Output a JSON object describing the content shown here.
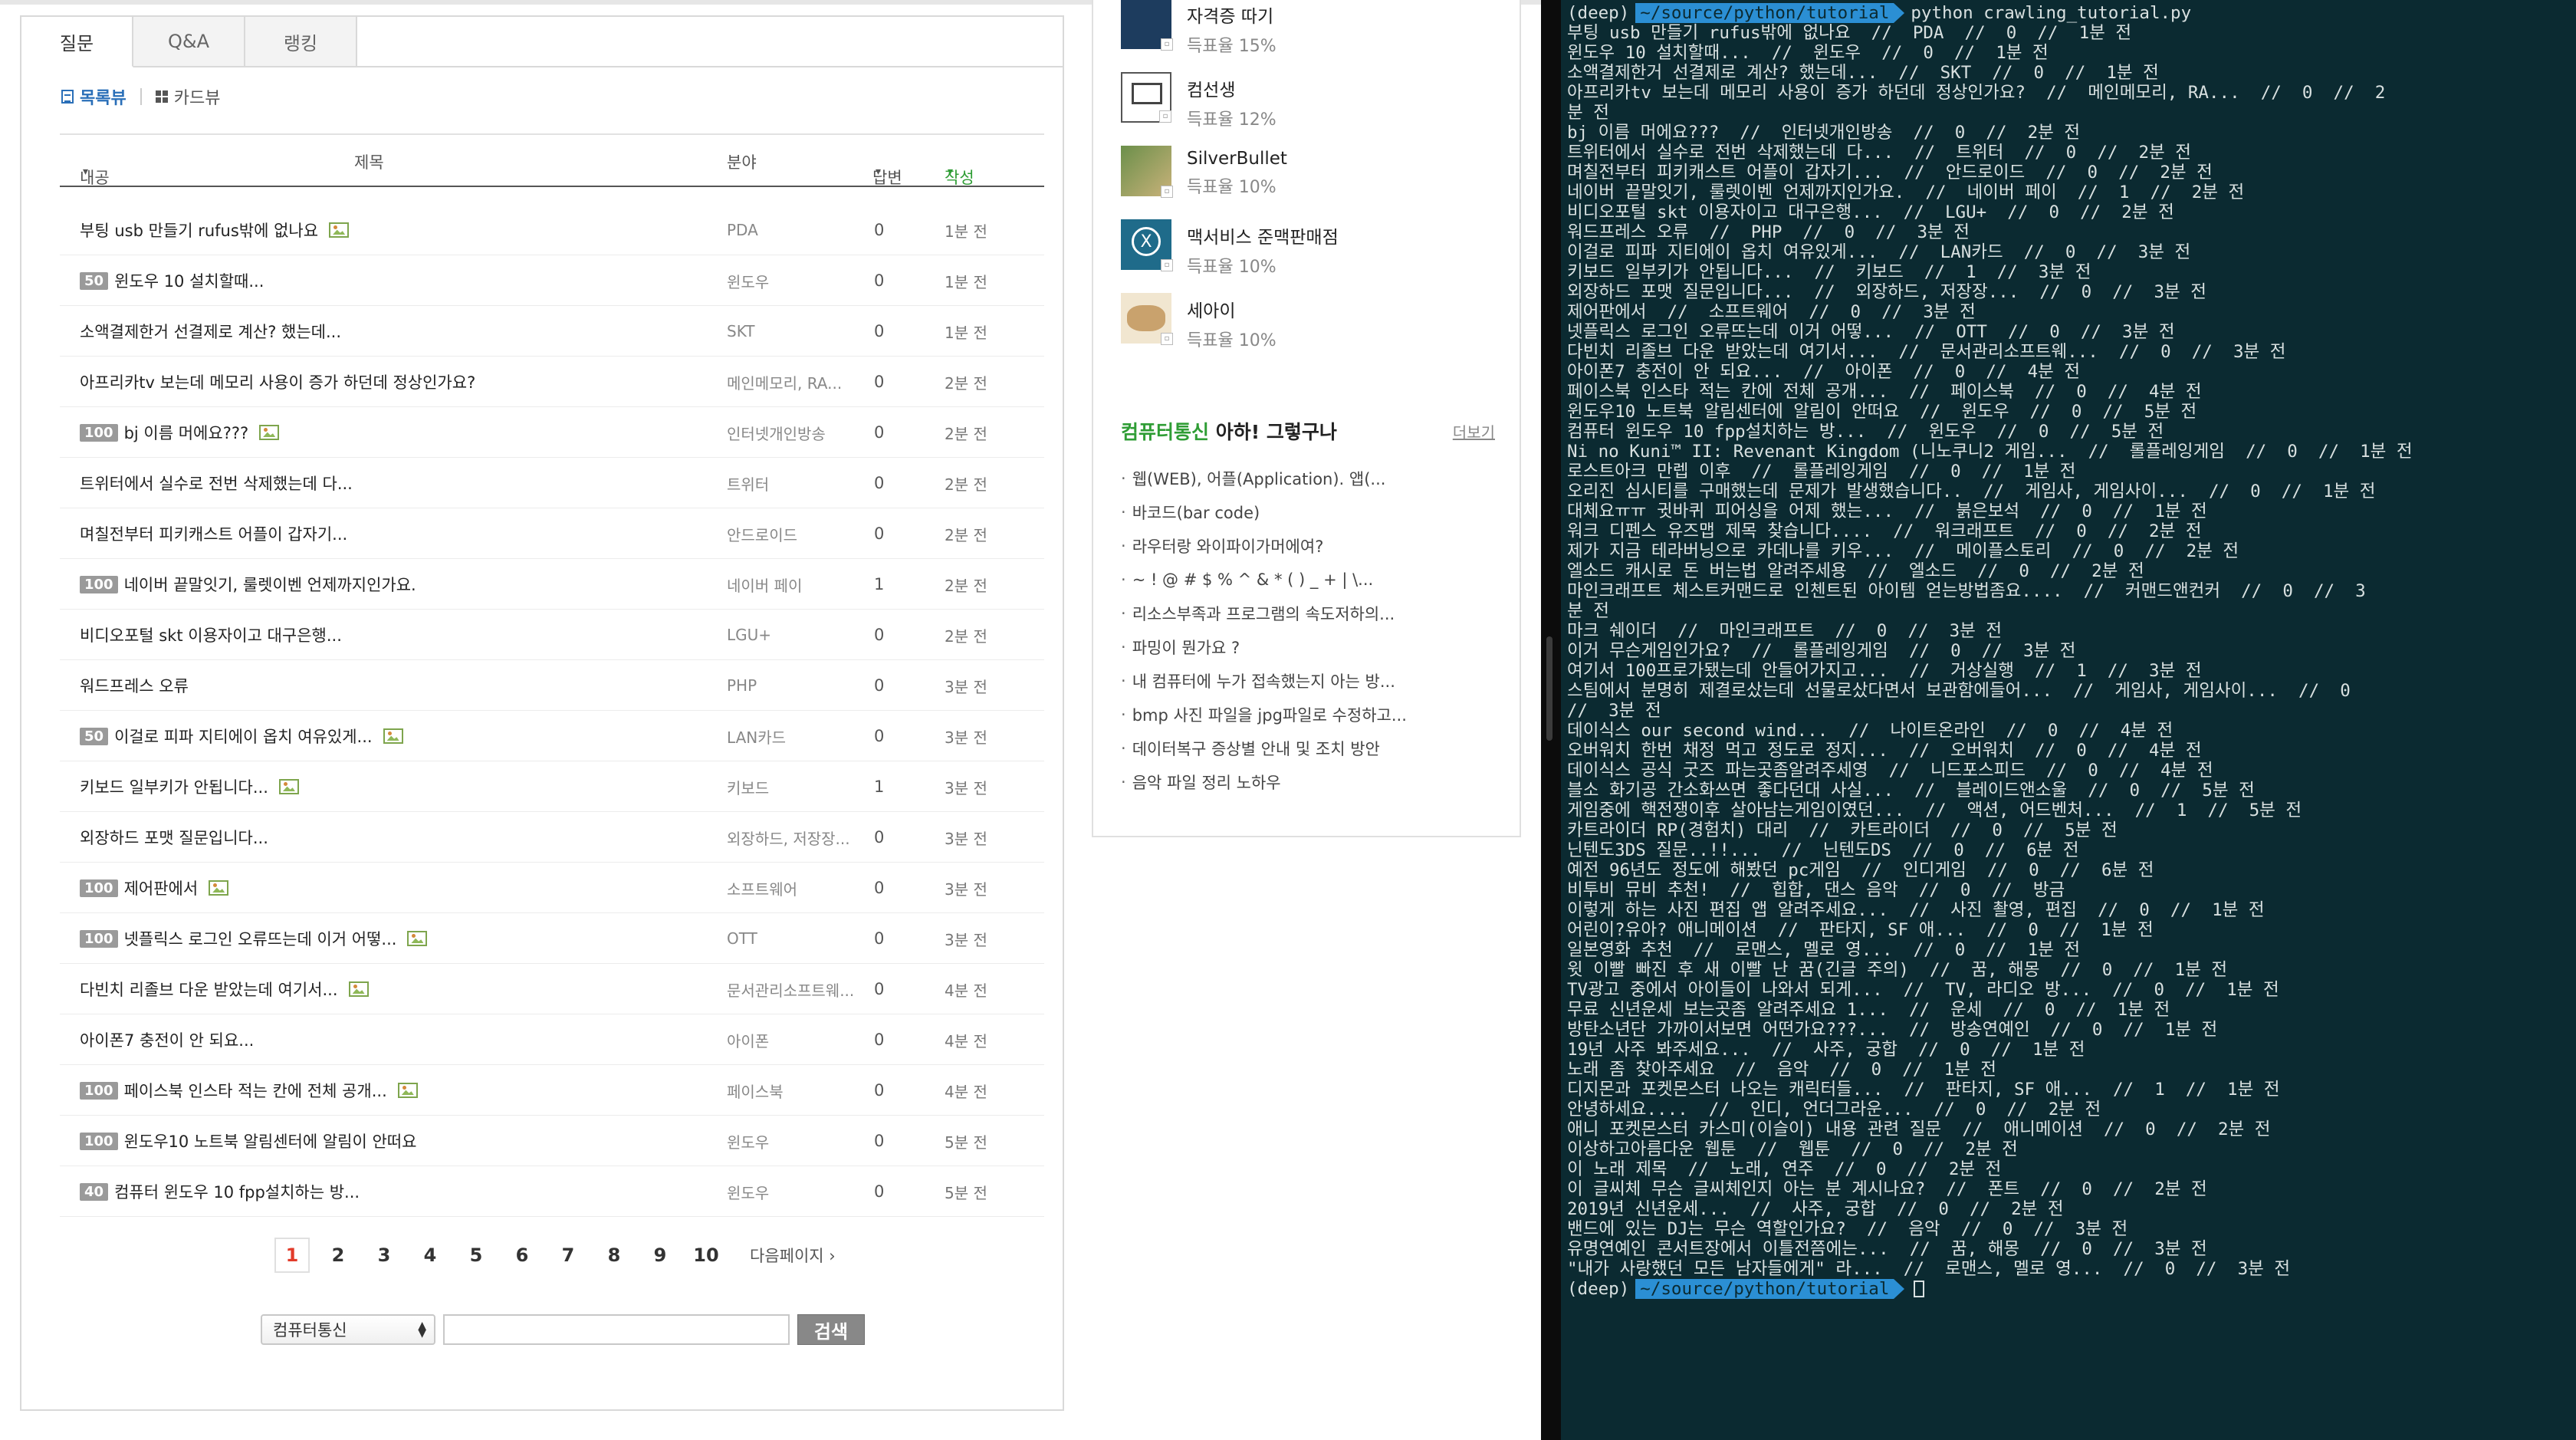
{
  "tabs": [
    "질문",
    "Q&A",
    "랭킹"
  ],
  "views": {
    "list": "목록뷰",
    "card": "카드뷰"
  },
  "columns": {
    "content": "내공",
    "title": "제목",
    "field": "분야",
    "answers": "답변",
    "written": "작성"
  },
  "questions": [
    {
      "badge": "",
      "title": "부팅 usb 만들기 rufus밖에 없나요",
      "img": true,
      "field": "PDA",
      "answers": "0",
      "time": "1분 전"
    },
    {
      "badge": "50",
      "title": "윈도우 10 설치할때...",
      "img": false,
      "field": "윈도우",
      "answers": "0",
      "time": "1분 전"
    },
    {
      "badge": "",
      "title": "소액결제한거 선결제로 계산? 했는데...",
      "img": false,
      "field": "SKT",
      "answers": "0",
      "time": "1분 전"
    },
    {
      "badge": "",
      "title": "아프리카tv 보는데 메모리 사용이 증가 하던데 정상인가요?",
      "img": false,
      "field": "메인메모리, RA...",
      "answers": "0",
      "time": "2분 전"
    },
    {
      "badge": "100",
      "title": "bj 이름 머에요???",
      "img": true,
      "field": "인터넷개인방송",
      "answers": "0",
      "time": "2분 전"
    },
    {
      "badge": "",
      "title": "트위터에서 실수로 전번 삭제했는데 다...",
      "img": false,
      "field": "트위터",
      "answers": "0",
      "time": "2분 전"
    },
    {
      "badge": "",
      "title": "며칠전부터 피키캐스트 어플이 갑자기...",
      "img": false,
      "field": "안드로이드",
      "answers": "0",
      "time": "2분 전"
    },
    {
      "badge": "100",
      "title": "네이버 끝말잇기, 룰렛이벤 언제까지인가요.",
      "img": false,
      "field": "네이버 페이",
      "answers": "1",
      "time": "2분 전"
    },
    {
      "badge": "",
      "title": "비디오포털 skt 이용자이고 대구은행...",
      "img": false,
      "field": "LGU+",
      "answers": "0",
      "time": "2분 전"
    },
    {
      "badge": "",
      "title": "워드프레스 오류",
      "img": false,
      "field": "PHP",
      "answers": "0",
      "time": "3분 전"
    },
    {
      "badge": "50",
      "title": "이걸로 피파 지티에이 옵치 여유있게...",
      "img": true,
      "field": "LAN카드",
      "answers": "0",
      "time": "3분 전"
    },
    {
      "badge": "",
      "title": "키보드 일부키가 안됩니다...",
      "img": true,
      "field": "키보드",
      "answers": "1",
      "time": "3분 전"
    },
    {
      "badge": "",
      "title": "외장하드 포맷 질문입니다...",
      "img": false,
      "field": "외장하드, 저장장...",
      "answers": "0",
      "time": "3분 전"
    },
    {
      "badge": "100",
      "title": "제어판에서",
      "img": true,
      "field": "소프트웨어",
      "answers": "0",
      "time": "3분 전"
    },
    {
      "badge": "100",
      "title": "넷플릭스 로그인 오류뜨는데 이거 어떻...",
      "img": true,
      "field": "OTT",
      "answers": "0",
      "time": "3분 전"
    },
    {
      "badge": "",
      "title": "다빈치 리졸브 다운 받았는데 여기서...",
      "img": true,
      "field": "문서관리소프트웨...",
      "answers": "0",
      "time": "4분 전"
    },
    {
      "badge": "",
      "title": "아이폰7 충전이 안 되요...",
      "img": false,
      "field": "아이폰",
      "answers": "0",
      "time": "4분 전"
    },
    {
      "badge": "100",
      "title": "페이스북 인스타 적는 칸에 전체 공개...",
      "img": true,
      "field": "페이스북",
      "answers": "0",
      "time": "4분 전"
    },
    {
      "badge": "100",
      "title": "윈도우10 노트북 알림센터에 알림이 안떠요",
      "img": false,
      "field": "윈도우",
      "answers": "0",
      "time": "5분 전"
    },
    {
      "badge": "40",
      "title": "컴퓨터 윈도우 10 fpp설치하는 방...",
      "img": false,
      "field": "윈도우",
      "answers": "0",
      "time": "5분 전"
    }
  ],
  "pagination": {
    "pages": [
      "1",
      "2",
      "3",
      "4",
      "5",
      "6",
      "7",
      "8",
      "9",
      "10"
    ],
    "current": "1",
    "next": "다음페이지"
  },
  "search": {
    "category": "컴퓨터통신",
    "value": "",
    "button": "검색"
  },
  "ranking": [
    {
      "name": "자격증 따기",
      "pct": "득표율 15%"
    },
    {
      "name": "컴선생",
      "pct": "득표율 12%"
    },
    {
      "name": "SilverBullet",
      "pct": "득표율 10%"
    },
    {
      "name": "맥서비스 준맥판매점",
      "pct": "득표율 10%"
    },
    {
      "name": "세아이",
      "pct": "득표율 10%"
    }
  ],
  "aha": {
    "title_green": "컴퓨터통신",
    "title_black": "아하! 그렇구나",
    "more": "더보기",
    "items": [
      "웹(WEB), 어플(Application). 앱(...",
      "바코드(bar code)",
      "라우터랑 와이파이가머에여?",
      "~ ! @ # $ % ^ & * ( ) _ + | \\...",
      "리소스부족과 프로그램의 속도저하의...",
      "파밍이 뭔가요 ?",
      "내 컴퓨터에 누가 접속했는지 아는 방...",
      "bmp 사진 파일을 jpg파일로 수정하고...",
      "데이터복구 증상별 안내 및 조치 방안",
      "음악 파일 정리 노하우"
    ]
  },
  "terminal": {
    "top_prompt": {
      "env": "(deep)",
      "path": "~/source/python/tutorial",
      "cmd": "python crawling_tutorial.py"
    },
    "lines": [
      "부팅 usb 만들기 rufus밖에 없나요  //  PDA  //  0  //  1분 전",
      "윈도우 10 설치할때...  //  윈도우  //  0  //  1분 전",
      "소액결제한거 선결제로 계산? 했는데...  //  SKT  //  0  //  1분 전",
      "아프리카tv 보는데 메모리 사용이 증가 하던데 정상인가요?  //  메인메모리, RA...  //  0  //  2",
      "분 전",
      "bj 이름 머에요???  //  인터넷개인방송  //  0  //  2분 전",
      "트위터에서 실수로 전번 삭제했는데 다...  //  트위터  //  0  //  2분 전",
      "며칠전부터 피키캐스트 어플이 갑자기...  //  안드로이드  //  0  //  2분 전",
      "네이버 끝말잇기, 룰렛이벤 언제까지인가요.  //  네이버 페이  //  1  //  2분 전",
      "비디오포털 skt 이용자이고 대구은행...  //  LGU+  //  0  //  2분 전",
      "워드프레스 오류  //  PHP  //  0  //  3분 전",
      "이걸로 피파 지티에이 옵치 여유있게...  //  LAN카드  //  0  //  3분 전",
      "키보드 일부키가 안됩니다...  //  키보드  //  1  //  3분 전",
      "외장하드 포맷 질문입니다...  //  외장하드, 저장장...  //  0  //  3분 전",
      "제어판에서  //  소프트웨어  //  0  //  3분 전",
      "넷플릭스 로그인 오류뜨는데 이거 어떻...  //  OTT  //  0  //  3분 전",
      "다빈치 리졸브 다운 받았는데 여기서...  //  문서관리소프트웨...  //  0  //  3분 전",
      "아이폰7 충전이 안 되요...  //  아이폰  //  0  //  4분 전",
      "페이스북 인스타 적는 칸에 전체 공개...  //  페이스북  //  0  //  4분 전",
      "윈도우10 노트북 알림센터에 알림이 안떠요  //  윈도우  //  0  //  5분 전",
      "컴퓨터 윈도우 10 fpp설치하는 방...  //  윈도우  //  0  //  5분 전",
      "Ni no Kuni™ II: Revenant Kingdom (니노쿠니2 게임...  //  롤플레잉게임  //  0  //  1분 전",
      "로스트아크 만렙 이후  //  롤플레잉게임  //  0  //  1분 전",
      "오리진 심시티를 구매했는데 문제가 발생했습니다..  //  게임사, 게임사이...  //  0  //  1분 전",
      "대체요ㅠㅠ 귓바퀴 피어싱을 어제 했는...  //  붉은보석  //  0  //  1분 전",
      "워크 디펜스 유즈맵 제목 찾습니다....  //  워크래프트  //  0  //  2분 전",
      "제가 지금 테라버닝으로 카데나를 키우...  //  메이플스토리  //  0  //  2분 전",
      "엘소드 캐시로 돈 버는법 알려주세용  //  엘소드  //  0  //  2분 전",
      "마인크래프트 체스트커맨드로 인첸트된 아이템 얻는방법좀요....  //  커맨드앤컨커  //  0  //  3",
      "분 전",
      "마크 쉐이더  //  마인크래프트  //  0  //  3분 전",
      "이거 무슨게임인가요?  //  롤플레잉게임  //  0  //  3분 전",
      "여기서 100프로가됐는데 안들어가지고...  //  거상실행  //  1  //  3분 전",
      "스팀에서 분명히 제결로샀는데 선물로샀다면서 보관함에들어...  //  게임사, 게임사이...  //  0",
      "//  3분 전",
      "데이식스 our second wind...  //  나이트온라인  //  0  //  4분 전",
      "오버워치 한번 채정 먹고 정도로 정지...  //  오버워치  //  0  //  4분 전",
      "데이식스 공식 굿즈 파는곳좀알려주세영  //  니드포스피드  //  0  //  4분 전",
      "블소 화기공 간소화쓰면 좋다던대 사실...  //  블레이드앤소울  //  0  //  5분 전",
      "게임중에 핵전쟁이후 살아남는게임이였던...  //  액션, 어드벤처...  //  1  //  5분 전",
      "카트라이더 RP(경험치) 대리  //  카트라이더  //  0  //  5분 전",
      "닌텐도3DS 질문..!!...  //  닌텐도DS  //  0  //  6분 전",
      "예전 96년도 정도에 해봤던 pc게임  //  인디게임  //  0  //  6분 전",
      "비투비 뮤비 추천!  //  힙합, 댄스 음악  //  0  //  방금",
      "이렇게 하는 사진 편집 앱 알려주세요...  //  사진 촬영, 편집  //  0  //  1분 전",
      "어린이?유아? 애니메이션  //  판타지, SF 애...  //  0  //  1분 전",
      "일본영화 추천  //  로맨스, 멜로 영...  //  0  //  1분 전",
      "윗 이빨 빠진 후 새 이빨 난 꿈(긴글 주의)  //  꿈, 해몽  //  0  //  1분 전",
      "TV광고 중에서 아이들이 나와서 되게...  //  TV, 라디오 방...  //  0  //  1분 전",
      "무료 신년운세 보는곳좀 알려주세요 1...  //  운세  //  0  //  1분 전",
      "방탄소년단 가까이서보면 어떤가요???...  //  방송연예인  //  0  //  1분 전",
      "19년 사주 봐주세요...  //  사주, 궁합  //  0  //  1분 전",
      "노래 좀 찾아주세요  //  음악  //  0  //  1분 전",
      "디지몬과 포켓몬스터 나오는 캐릭터들...  //  판타지, SF 애...  //  1  //  1분 전",
      "안녕하세요....  //  인디, 언더그라운...  //  0  //  2분 전",
      "애니 포켓몬스터 카스미(이슬이) 내용 관련 질문  //  애니메이션  //  0  //  2분 전",
      "이상하고아름다운 웹툰  //  웹툰  //  0  //  2분 전",
      "이 노래 제목  //  노래, 연주  //  0  //  2분 전",
      "이 글씨체 무슨 글씨체인지 아는 분 계시나요?  //  폰트  //  0  //  2분 전",
      "2019년 신년운세...  //  사주, 궁합  //  0  //  2분 전",
      "밴드에 있는 DJ는 무슨 역할인가요?  //  음악  //  0  //  3분 전",
      "유명연예인 콘서트장에서 이틀전쯤에는...  //  꿈, 해몽  //  0  //  3분 전",
      "\"내가 사랑했던 모든 남자들에게\" 라...  //  로맨스, 멜로 영...  //  0  //  3분 전"
    ],
    "bottom_prompt": {
      "env": "(deep)",
      "path": "~/source/python/tutorial"
    }
  },
  "colors": {
    "accent_green": "#2f9d35",
    "link_blue": "#2a6fb8",
    "terminal_bg": "#0b2a31",
    "prompt_blue": "#2b8fd4"
  }
}
